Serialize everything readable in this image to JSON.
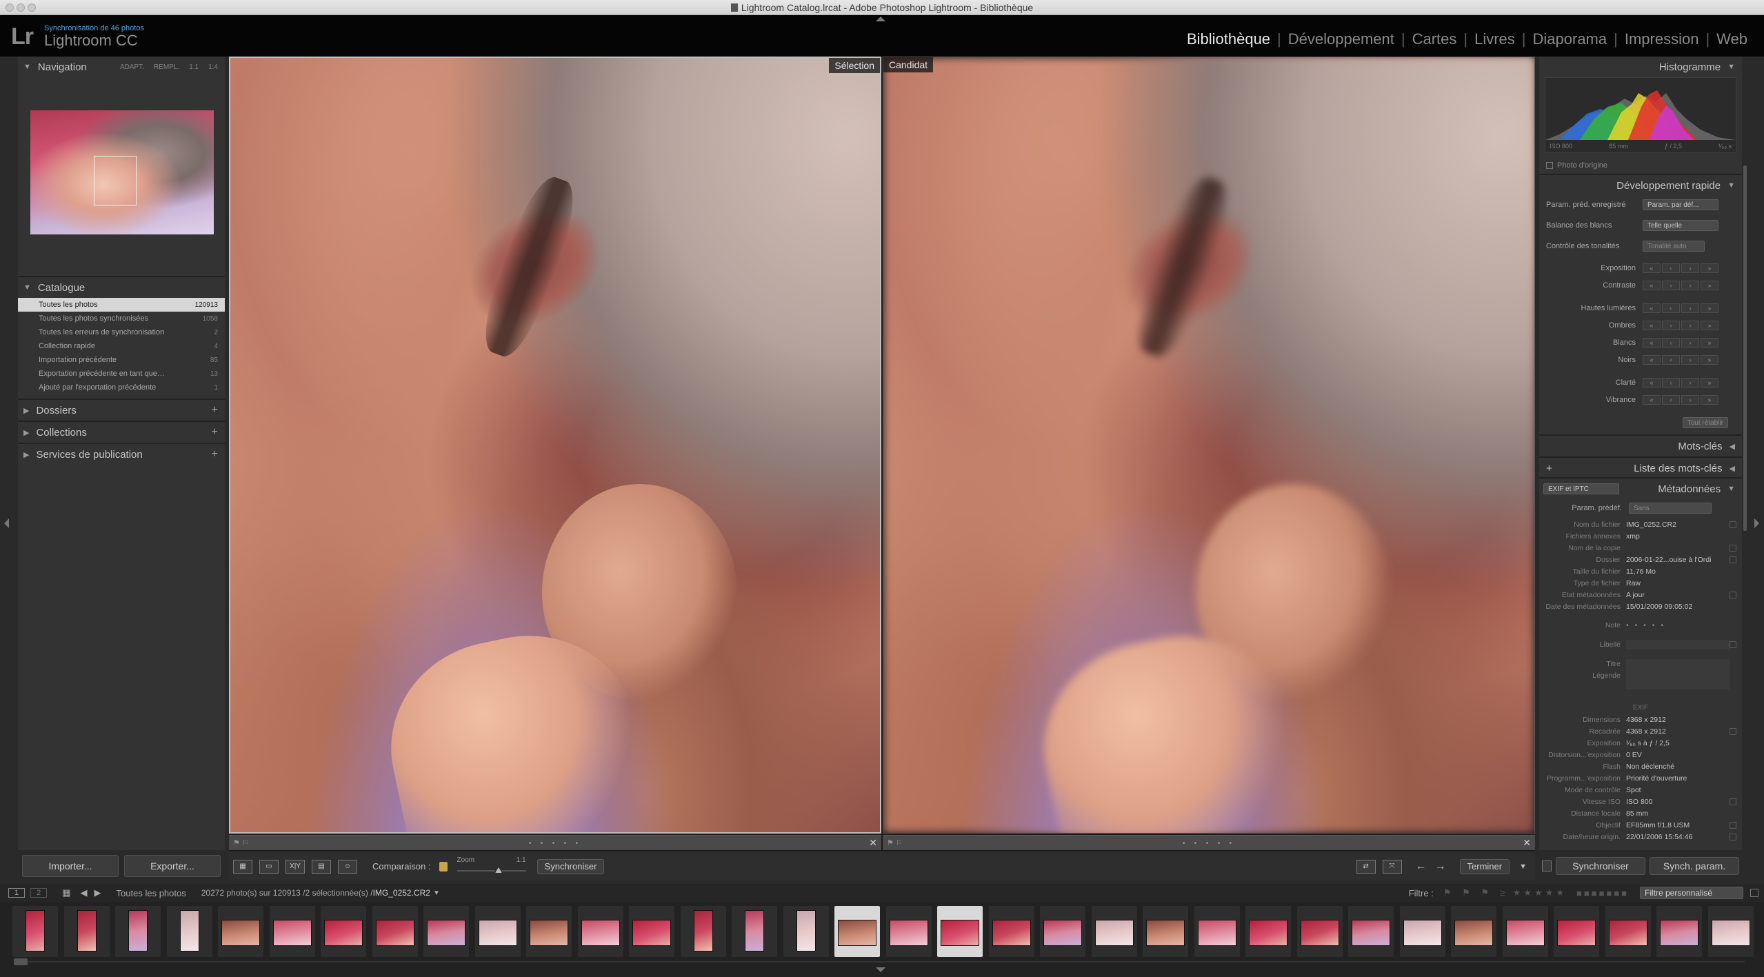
{
  "window": {
    "title": "Lightroom Catalog.lrcat - Adobe Photoshop Lightroom - Bibliothèque"
  },
  "identity": {
    "logo": "Lr",
    "sync_status": "Synchronisation de 46 photos",
    "app_name": "Lightroom CC"
  },
  "modules": [
    "Bibliothèque",
    "Développement",
    "Cartes",
    "Livres",
    "Diaporama",
    "Impression",
    "Web"
  ],
  "active_module": "Bibliothèque",
  "navigator": {
    "title": "Navigation",
    "zoom_options": [
      "ADAPT.",
      "REMPL.",
      "1:1",
      "1:4"
    ]
  },
  "catalog": {
    "title": "Catalogue",
    "items": [
      {
        "label": "Toutes les photos",
        "count": "120913"
      },
      {
        "label": "Toutes les photos synchronisées",
        "count": "1058"
      },
      {
        "label": "Toutes les erreurs de synchronisation",
        "count": "2"
      },
      {
        "label": "Collection rapide",
        "count": "4"
      },
      {
        "label": "Importation précédente",
        "count": "85"
      },
      {
        "label": "Exportation précédente en tant que…",
        "count": "13"
      },
      {
        "label": "Ajouté par l'exportation précédente",
        "count": "1"
      }
    ]
  },
  "left_sections": [
    "Dossiers",
    "Collections",
    "Services de publication"
  ],
  "left_buttons": {
    "import": "Importer...",
    "export": "Exporter..."
  },
  "compare": {
    "select_label": "Sélection",
    "candidate_label": "Candidat",
    "footer_dots": "• • • • •"
  },
  "toolbar": {
    "compare_label": "Comparaison :",
    "zoom_label": "Zoom",
    "zoom_value": "1:1",
    "sync_button": "Synchroniser",
    "done_button": "Terminer",
    "xy_label": "X|Y"
  },
  "histogram": {
    "title": "Histogramme",
    "iso": "ISO 800",
    "focal": "85 mm",
    "aperture": "ƒ / 2,5",
    "shutter": "¹⁄₆₀ s",
    "original_photo": "Photo d'origine",
    "colors": {
      "red": "#e0302c",
      "green": "#35b238",
      "blue": "#2c6fe0",
      "yellow": "#e8d42a",
      "magenta": "#c83ad2"
    }
  },
  "quick_develop": {
    "title": "Développement rapide",
    "saved_preset_label": "Param. préd. enregistré",
    "saved_preset_value": "Param. par déf...",
    "white_balance_label": "Balance des blancs",
    "white_balance_value": "Telle quelle",
    "tone_control_label": "Contrôle des tonalités",
    "auto_tone": "Tonalité auto",
    "sliders": [
      "Exposition",
      "Contraste",
      "Hautes lumières",
      "Ombres",
      "Blancs",
      "Noirs",
      "Clarté",
      "Vibrance"
    ],
    "reset_all": "Tout rétablir"
  },
  "keywording": {
    "title": "Mots-clés"
  },
  "keyword_list": {
    "title": "Liste des mots-clés"
  },
  "metadata": {
    "title": "Métadonnées",
    "mode": "EXIF et IPTC",
    "preset_label": "Param. prédéf.",
    "preset_value": "Sans",
    "rows": [
      {
        "k": "Nom du fichier",
        "v": "IMG_0252.CR2"
      },
      {
        "k": "Fichiers annexes",
        "v": "xmp"
      },
      {
        "k": "Nom de la copie",
        "v": ""
      },
      {
        "k": "Dossier",
        "v": "2006-01-22...ouise à l'Ordi"
      },
      {
        "k": "Taille du fichier",
        "v": "11,76 Mo"
      },
      {
        "k": "Type de fichier",
        "v": "Raw"
      },
      {
        "k": "Etat métadonnées",
        "v": "A jour"
      },
      {
        "k": "Date des métadonnées",
        "v": "15/01/2009 09:05:02"
      }
    ],
    "rating_label": "Note",
    "rating_dots": "• • • • •",
    "label_label": "Libellé",
    "title_label": "Titre",
    "caption_label": "Légende",
    "exif_header": "EXIF",
    "exif_rows": [
      {
        "k": "Dimensions",
        "v": "4368 x 2912"
      },
      {
        "k": "Recadrée",
        "v": "4368 x 2912"
      },
      {
        "k": "Exposition",
        "v": "¹⁄₆₀ s à ƒ / 2,5"
      },
      {
        "k": "Distorsion...'exposition",
        "v": "0 EV"
      },
      {
        "k": "Flash",
        "v": "Non déclenché"
      },
      {
        "k": "Programm...'exposition",
        "v": "Priorité d'ouverture"
      },
      {
        "k": "Mode de contrôle",
        "v": "Spot"
      },
      {
        "k": "Vitesse ISO",
        "v": "ISO 800"
      },
      {
        "k": "Distance focale",
        "v": "85 mm"
      },
      {
        "k": "Objectif",
        "v": "EF85mm f/1.8 USM"
      },
      {
        "k": "Date/heure origin.",
        "v": "22/01/2006 15:54:46"
      }
    ]
  },
  "right_buttons": {
    "sync": "Synchroniser",
    "sync_settings": "Synch. param."
  },
  "filmstrip_bar": {
    "view1": "1",
    "view2": "2",
    "source": "Toutes les photos",
    "count_text": "20272 photo(s) sur 120913 /2 sélectionnée(s) /",
    "filename": "IMG_0252.CR2",
    "filter_label": "Filtre :",
    "filter_value": "Filtre personnalisé"
  }
}
